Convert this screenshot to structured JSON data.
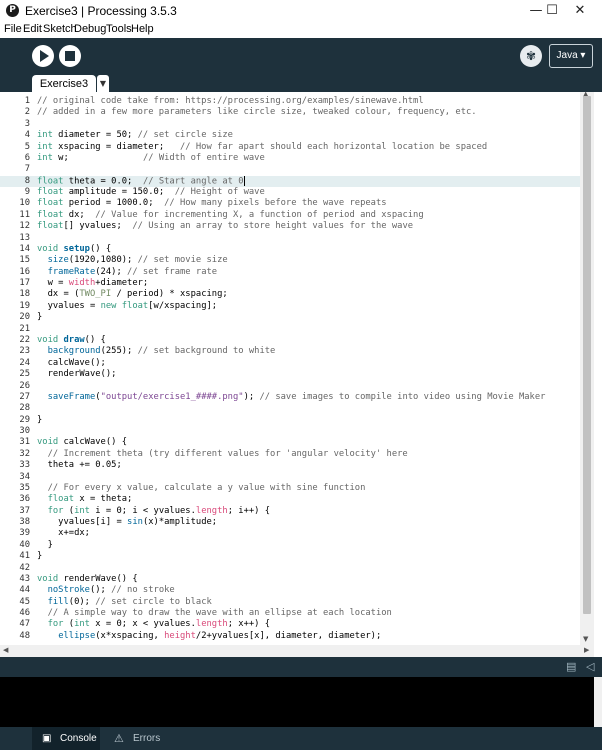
{
  "window": {
    "title": "Exercise3 | Processing 3.5.3",
    "app_icon_glyph": "P",
    "minimize_glyph": "—",
    "maximize_glyph": "☐",
    "close_glyph": "✕"
  },
  "menu": [
    "File",
    "Edit",
    "Sketch",
    "Debug",
    "Tools",
    "Help"
  ],
  "toolbar": {
    "run_icon": "play-icon",
    "stop_icon": "stop-icon",
    "debug_icon": "butterfly-icon",
    "mode_label": "Java ▾"
  },
  "tabs": [
    {
      "label": "Exercise3"
    }
  ],
  "tab_menu_glyph": "▼",
  "editor": {
    "active_line": 8,
    "lines": [
      {
        "n": "1",
        "t": [
          [
            "c",
            "// original code take from: https://processing.org/examples/sinewave.html"
          ]
        ]
      },
      {
        "n": "2",
        "t": [
          [
            "c",
            "// added in a few more parameters like circle size, tweaked colour, frequency, etc."
          ]
        ]
      },
      {
        "n": "3",
        "t": []
      },
      {
        "n": "4",
        "t": [
          [
            "k",
            "int"
          ],
          [
            "p",
            " diameter = 50; "
          ],
          [
            "c",
            "// set circle size"
          ]
        ]
      },
      {
        "n": "5",
        "t": [
          [
            "k",
            "int"
          ],
          [
            "p",
            " xspacing = diameter;   "
          ],
          [
            "c",
            "// How far apart should each horizontal location be spaced"
          ]
        ]
      },
      {
        "n": "6",
        "t": [
          [
            "k",
            "int"
          ],
          [
            "p",
            " w;              "
          ],
          [
            "c",
            "// Width of entire wave"
          ]
        ]
      },
      {
        "n": "7",
        "t": []
      },
      {
        "n": "8",
        "t": [
          [
            "k",
            "float"
          ],
          [
            "p",
            " theta = 0.0;  "
          ],
          [
            "c",
            "// Start angle at 0"
          ]
        ]
      },
      {
        "n": "9",
        "t": [
          [
            "k",
            "float"
          ],
          [
            "p",
            " amplitude = 150.0;  "
          ],
          [
            "c",
            "// Height of wave"
          ]
        ]
      },
      {
        "n": "10",
        "t": [
          [
            "k",
            "float"
          ],
          [
            "p",
            " period = 1000.0;  "
          ],
          [
            "c",
            "// How many pixels before the wave repeats"
          ]
        ]
      },
      {
        "n": "11",
        "t": [
          [
            "k",
            "float"
          ],
          [
            "p",
            " dx;  "
          ],
          [
            "c",
            "// Value for incrementing X, a function of period and xspacing"
          ]
        ]
      },
      {
        "n": "12",
        "t": [
          [
            "k",
            "float"
          ],
          [
            "p",
            "[] yvalues;  "
          ],
          [
            "c",
            "// Using an array to store height values for the wave"
          ]
        ]
      },
      {
        "n": "13",
        "t": []
      },
      {
        "n": "14",
        "t": [
          [
            "k",
            "void"
          ],
          [
            "p",
            " "
          ],
          [
            "fb",
            "setup"
          ],
          [
            "p",
            "() {"
          ]
        ]
      },
      {
        "n": "15",
        "t": [
          [
            "p",
            "  "
          ],
          [
            "f",
            "size"
          ],
          [
            "p",
            "(1920,1080); "
          ],
          [
            "c",
            "// set movie size"
          ]
        ]
      },
      {
        "n": "16",
        "t": [
          [
            "p",
            "  "
          ],
          [
            "f",
            "frameRate"
          ],
          [
            "p",
            "(24); "
          ],
          [
            "c",
            "// set frame rate"
          ]
        ]
      },
      {
        "n": "17",
        "t": [
          [
            "p",
            "  w = "
          ],
          [
            "v",
            "width"
          ],
          [
            "p",
            "+diameter;"
          ]
        ]
      },
      {
        "n": "18",
        "t": [
          [
            "p",
            "  dx = ("
          ],
          [
            "o",
            "TWO_PI"
          ],
          [
            "p",
            " / period) * xspacing;"
          ]
        ]
      },
      {
        "n": "19",
        "t": [
          [
            "p",
            "  yvalues = "
          ],
          [
            "k",
            "new"
          ],
          [
            "p",
            " "
          ],
          [
            "k",
            "float"
          ],
          [
            "p",
            "[w/xspacing];"
          ]
        ]
      },
      {
        "n": "20",
        "t": [
          [
            "p",
            "}"
          ]
        ]
      },
      {
        "n": "21",
        "t": []
      },
      {
        "n": "22",
        "t": [
          [
            "k",
            "void"
          ],
          [
            "p",
            " "
          ],
          [
            "fb",
            "draw"
          ],
          [
            "p",
            "() {"
          ]
        ]
      },
      {
        "n": "23",
        "t": [
          [
            "p",
            "  "
          ],
          [
            "f",
            "background"
          ],
          [
            "p",
            "(255); "
          ],
          [
            "c",
            "// set background to white"
          ]
        ]
      },
      {
        "n": "24",
        "t": [
          [
            "p",
            "  calcWave();"
          ]
        ]
      },
      {
        "n": "25",
        "t": [
          [
            "p",
            "  renderWave();"
          ]
        ]
      },
      {
        "n": "26",
        "t": []
      },
      {
        "n": "27",
        "t": [
          [
            "p",
            "  "
          ],
          [
            "f",
            "saveFrame"
          ],
          [
            "p",
            "("
          ],
          [
            "s",
            "\"output/exercise1_####.png\""
          ],
          [
            "p",
            "); "
          ],
          [
            "c",
            "// save images to compile into video using Movie Maker"
          ]
        ]
      },
      {
        "n": "28",
        "t": []
      },
      {
        "n": "29",
        "t": [
          [
            "p",
            "}"
          ]
        ]
      },
      {
        "n": "30",
        "t": []
      },
      {
        "n": "31",
        "t": [
          [
            "k",
            "void"
          ],
          [
            "p",
            " calcWave() {"
          ]
        ]
      },
      {
        "n": "32",
        "t": [
          [
            "p",
            "  "
          ],
          [
            "c",
            "// Increment theta (try different values for 'angular velocity' here"
          ]
        ]
      },
      {
        "n": "33",
        "t": [
          [
            "p",
            "  theta += 0.05;"
          ]
        ]
      },
      {
        "n": "34",
        "t": []
      },
      {
        "n": "35",
        "t": [
          [
            "p",
            "  "
          ],
          [
            "c",
            "// For every x value, calculate a y value with sine function"
          ]
        ]
      },
      {
        "n": "36",
        "t": [
          [
            "p",
            "  "
          ],
          [
            "k",
            "float"
          ],
          [
            "p",
            " x = theta;"
          ]
        ]
      },
      {
        "n": "37",
        "t": [
          [
            "p",
            "  "
          ],
          [
            "k",
            "for"
          ],
          [
            "p",
            " ("
          ],
          [
            "k",
            "int"
          ],
          [
            "p",
            " i = 0; i < yvalues."
          ],
          [
            "v",
            "length"
          ],
          [
            "p",
            "; i++) {"
          ]
        ]
      },
      {
        "n": "38",
        "t": [
          [
            "p",
            "    yvalues[i] = "
          ],
          [
            "f",
            "sin"
          ],
          [
            "p",
            "(x)*amplitude;"
          ]
        ]
      },
      {
        "n": "39",
        "t": [
          [
            "p",
            "    x+=dx;"
          ]
        ]
      },
      {
        "n": "40",
        "t": [
          [
            "p",
            "  }"
          ]
        ]
      },
      {
        "n": "41",
        "t": [
          [
            "p",
            "}"
          ]
        ]
      },
      {
        "n": "42",
        "t": []
      },
      {
        "n": "43",
        "t": [
          [
            "k",
            "void"
          ],
          [
            "p",
            " renderWave() {"
          ]
        ]
      },
      {
        "n": "44",
        "t": [
          [
            "p",
            "  "
          ],
          [
            "f",
            "noStroke"
          ],
          [
            "p",
            "(); "
          ],
          [
            "c",
            "// no stroke"
          ]
        ]
      },
      {
        "n": "45",
        "t": [
          [
            "p",
            "  "
          ],
          [
            "f",
            "fill"
          ],
          [
            "p",
            "(0); "
          ],
          [
            "c",
            "// set circle to black"
          ]
        ]
      },
      {
        "n": "46",
        "t": [
          [
            "p",
            "  "
          ],
          [
            "c",
            "// A simple way to draw the wave with an ellipse at each location"
          ]
        ]
      },
      {
        "n": "47",
        "t": [
          [
            "p",
            "  "
          ],
          [
            "k",
            "for"
          ],
          [
            "p",
            " ("
          ],
          [
            "k",
            "int"
          ],
          [
            "p",
            " x = 0; x < yvalues."
          ],
          [
            "v",
            "length"
          ],
          [
            "p",
            "; x++) {"
          ]
        ]
      },
      {
        "n": "48",
        "t": [
          [
            "p",
            "    "
          ],
          [
            "f",
            "ellipse"
          ],
          [
            "p",
            "(x*xspacing, "
          ],
          [
            "v",
            "height"
          ],
          [
            "p",
            "/2+yvalues[x], diameter, diameter);"
          ]
        ]
      }
    ]
  },
  "status_icons": [
    "document-icon",
    "collapse-arrow-icon"
  ],
  "status_glyphs": {
    "document": "▤",
    "collapse": "◁"
  },
  "bottom_tabs": [
    {
      "label": "Console",
      "icon": "console-icon",
      "icon_glyph": "▣",
      "active": true
    },
    {
      "label": "Errors",
      "icon": "warning-icon",
      "icon_glyph": "⚠",
      "active": false
    }
  ],
  "colors": {
    "toolbar_bg": "#1e313c",
    "comment": "#666666",
    "keyword": "#33997e",
    "function": "#006699",
    "string": "#7d4793",
    "builtin_var": "#d94a7a",
    "constant": "#718a62",
    "active_line": "#e3eef0"
  }
}
